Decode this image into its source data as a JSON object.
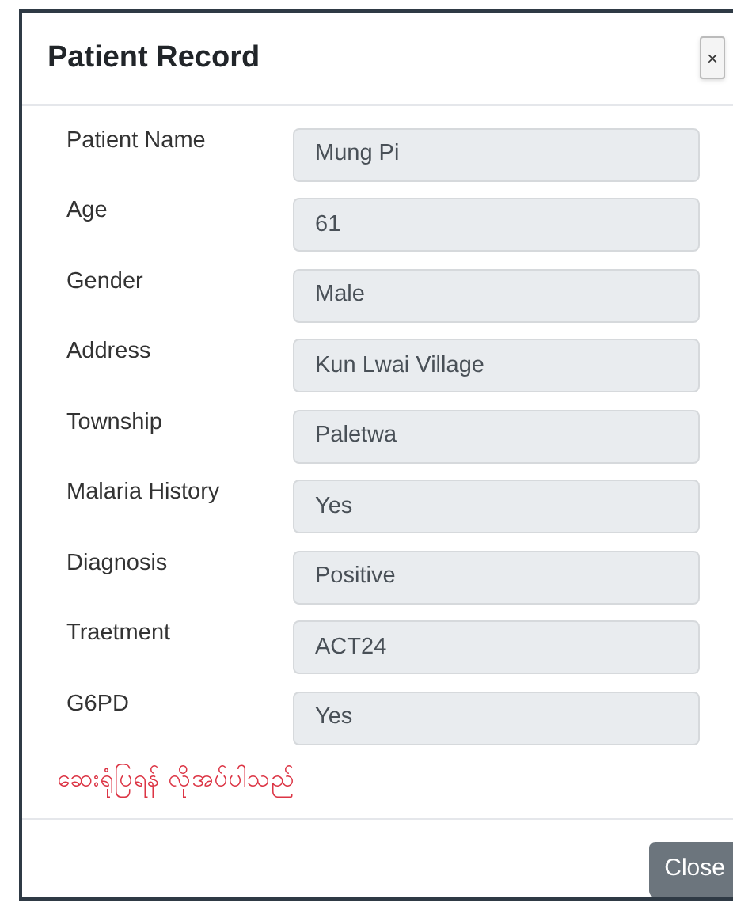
{
  "dialog": {
    "title": "Patient Record",
    "close_icon": "×"
  },
  "fields": [
    {
      "label": "Patient Name",
      "value": "Mung Pi"
    },
    {
      "label": "Age",
      "value": "61"
    },
    {
      "label": "Gender",
      "value": "Male"
    },
    {
      "label": "Address",
      "value": "Kun Lwai Village"
    },
    {
      "label": "Township",
      "value": "Paletwa"
    },
    {
      "label": "Malaria History",
      "value": "Yes"
    },
    {
      "label": "Diagnosis",
      "value": "Positive"
    },
    {
      "label": "Traetment",
      "value": "ACT24"
    },
    {
      "label": "G6PD",
      "value": "Yes"
    }
  ],
  "message": "ဆေးရုံပြရန် လိုအပ်ပါသည်",
  "buttons": [
    "Close"
  ]
}
